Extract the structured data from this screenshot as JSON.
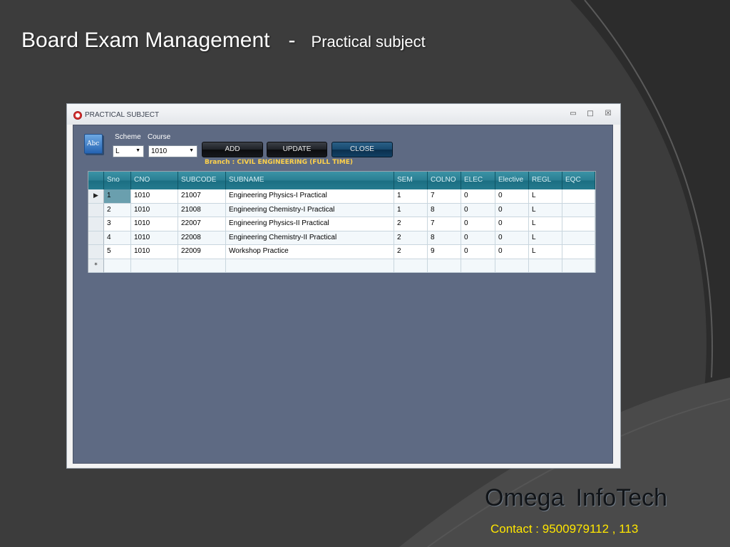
{
  "slide": {
    "title": "Board Exam Management",
    "dash": "-",
    "subtitle": "Practical subject",
    "brand_word1": "Omega",
    "brand_word2": "InfoTech",
    "contact": "Contact : 9500979112 , 113"
  },
  "window": {
    "title": "PRACTICAL SUBJECT",
    "minimize": "▭",
    "maximize": "□",
    "close": "☒"
  },
  "form": {
    "icon_text": "Abc",
    "scheme_label": "Scheme",
    "course_label": "Course",
    "scheme_value": "L",
    "course_value": "1010",
    "add_label": "ADD",
    "update_label": "UPDATE",
    "close_label": "CLOSE",
    "branch": "Branch : CIVIL ENGINEERING (FULL TIME)"
  },
  "grid": {
    "columns": [
      "Sno",
      "CNO",
      "SUBCODE",
      "SUBNAME",
      "SEM",
      "COLNO",
      "ELEC",
      "Elective",
      "REGL",
      "EQC"
    ],
    "rows": [
      [
        "1",
        "1010",
        "21007",
        "Engineering Physics-I Practical",
        "1",
        "7",
        "0",
        "0",
        "L",
        ""
      ],
      [
        "2",
        "1010",
        "21008",
        "Engineering Chemistry-I Practical",
        "1",
        "8",
        "0",
        "0",
        "L",
        ""
      ],
      [
        "3",
        "1010",
        "22007",
        "Engineering Physics-II Practical",
        "2",
        "7",
        "0",
        "0",
        "L",
        ""
      ],
      [
        "4",
        "1010",
        "22008",
        "Engineering Chemistry-II Practical",
        "2",
        "8",
        "0",
        "0",
        "L",
        ""
      ],
      [
        "5",
        "1010",
        "22009",
        "Workshop Practice",
        "2",
        "9",
        "0",
        "0",
        "L",
        ""
      ]
    ],
    "new_row_marker": "*",
    "current_row_marker": "▶"
  }
}
